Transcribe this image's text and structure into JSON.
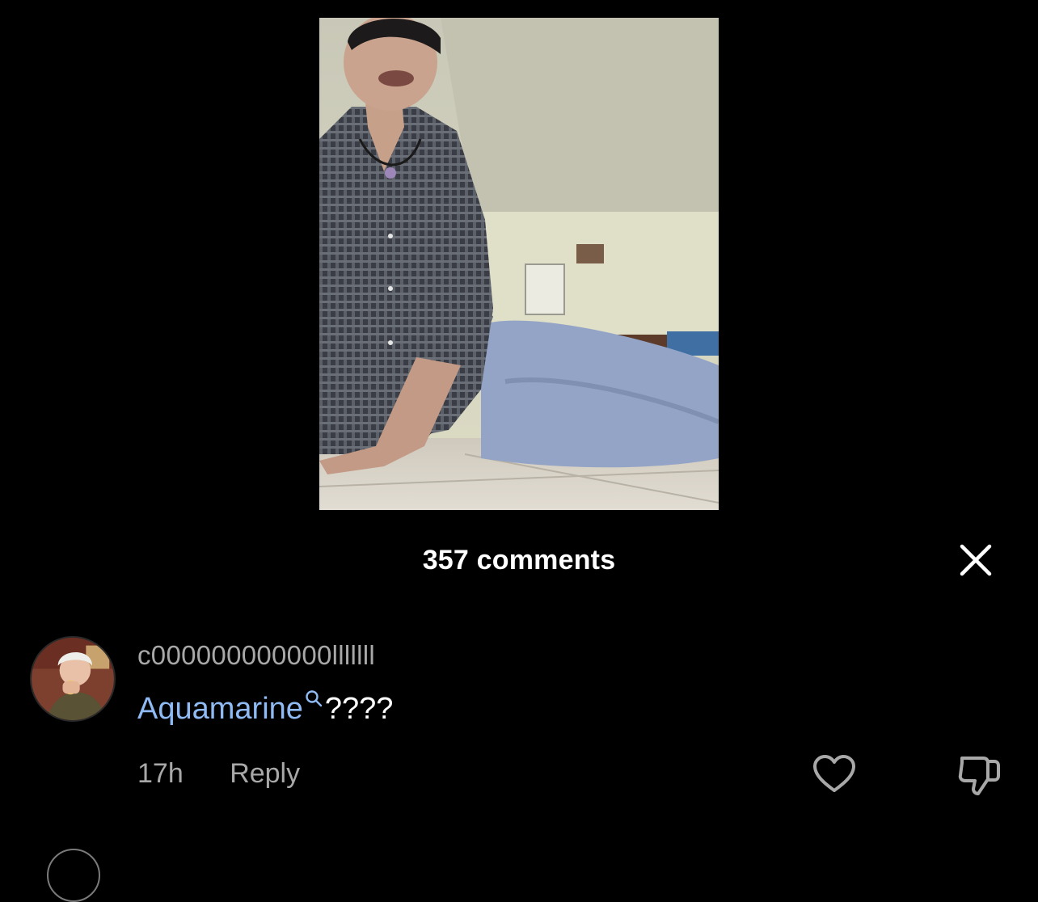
{
  "header": {
    "comments_count_label": "357 comments"
  },
  "icons": {
    "close": "close-icon",
    "search": "search-icon",
    "like": "heart-icon",
    "dislike": "thumbs-down-icon"
  },
  "comments": [
    {
      "username": "c000000000000lllllll",
      "text_link": "Aquamarine",
      "text_suffix": "????",
      "time": "17h",
      "reply_label": "Reply"
    }
  ],
  "colors": {
    "background": "#000000",
    "link": "#8fbaf3",
    "muted_text": "#a8a8a8"
  }
}
